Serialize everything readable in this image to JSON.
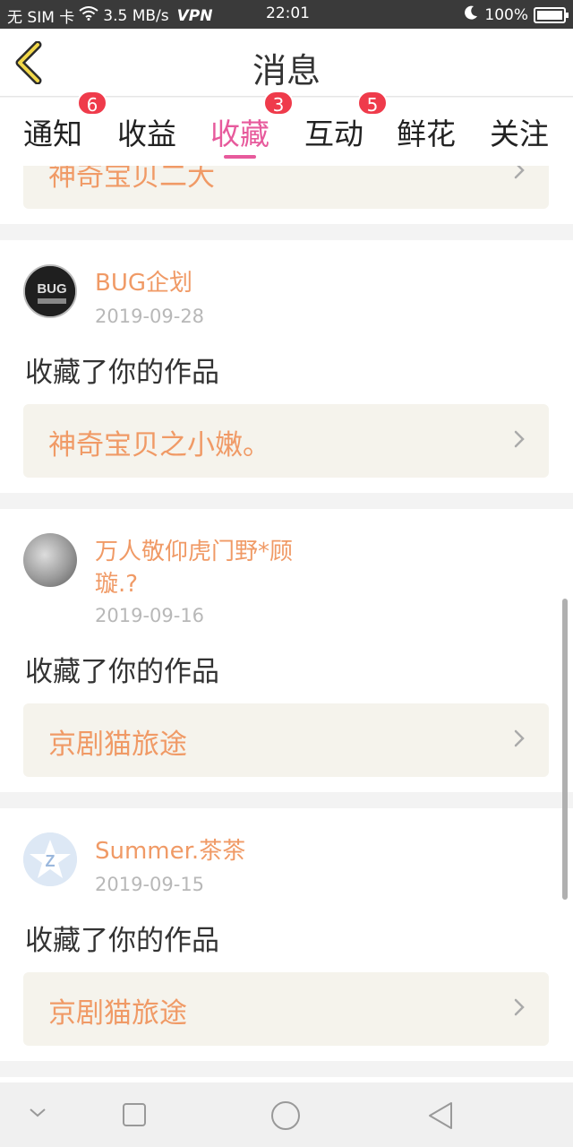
{
  "status_bar": {
    "carrier": "无 SIM 卡",
    "speed": "3.5 MB/s",
    "vpn": "VPN",
    "time": "22:01",
    "battery": "100%"
  },
  "header": {
    "title": "消息"
  },
  "tabs": [
    {
      "label": "通知",
      "badge": "6"
    },
    {
      "label": "收益",
      "badge": ""
    },
    {
      "label": "收藏",
      "badge": "3"
    },
    {
      "label": "互动",
      "badge": "5"
    },
    {
      "label": "鲜花",
      "badge": ""
    },
    {
      "label": "关注",
      "badge": ""
    }
  ],
  "active_tab": "收藏",
  "feed": {
    "partial_item": {
      "work_title": "神奇宝贝二大"
    },
    "items": [
      {
        "username": "BUG企划",
        "date": "2019-09-28",
        "action": "收藏了你的作品",
        "work_title": "神奇宝贝之小嫩。",
        "avatar_text": "BUG"
      },
      {
        "username_line1": "万人敬仰虎门野*顾",
        "username_line2": "璇.?",
        "date": "2019-09-16",
        "action": "收藏了你的作品",
        "work_title": "京剧猫旅途"
      },
      {
        "username": "Summer.茶茶",
        "date": "2019-09-15",
        "action": "收藏了你的作品",
        "work_title": "京剧猫旅途",
        "avatar_text": "Z"
      }
    ]
  },
  "colors": {
    "accent_pink": "#e75a9c",
    "name_orange": "#f09a66",
    "badge_red": "#ef3b4b",
    "work_box_bg": "#f5f3ec"
  }
}
